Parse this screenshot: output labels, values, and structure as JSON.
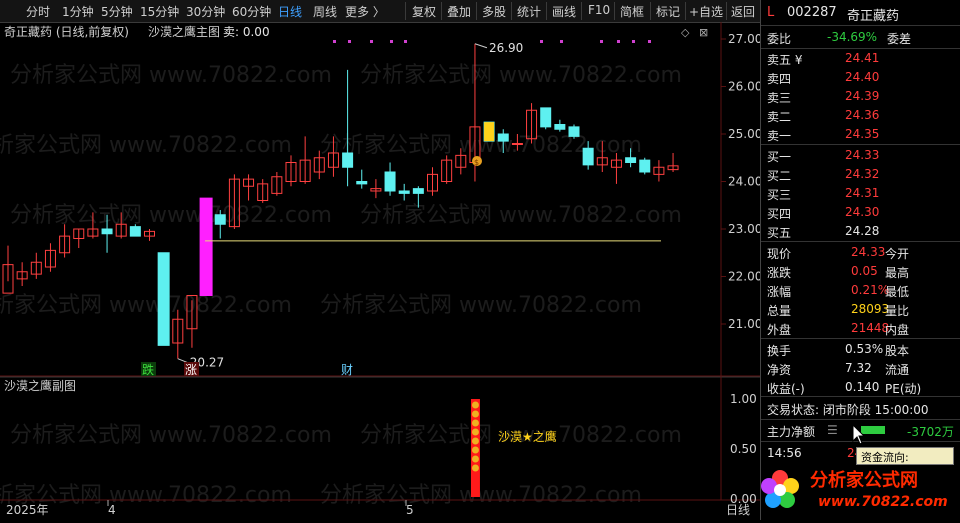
{
  "toolbar": {
    "periods": [
      "分时",
      "1分钟",
      "5分钟",
      "15分钟",
      "30分钟",
      "60分钟",
      "日线",
      "周线",
      "更多 〉"
    ],
    "active_period": "日线",
    "actions": [
      "复权",
      "叠加",
      "多股",
      "统计",
      "画线",
      "F10",
      "简框",
      "标记",
      "+自选",
      "返回"
    ]
  },
  "chart_header": {
    "title": "奇正藏药 (日线,前复权)",
    "indicator": "沙漠之鹰主图",
    "sell_label": "卖: 0.00"
  },
  "price_axis": [
    "27.00",
    "26.00",
    "25.00",
    "24.00",
    "23.00",
    "22.00",
    "21.00"
  ],
  "sub_axis": [
    "1.00",
    "0.50",
    "0.00"
  ],
  "annotations": {
    "high": "26.90",
    "low": "20.27",
    "marker_die": "跌",
    "marker_zhang": "涨",
    "marker_cai": "财",
    "sub_label": "沙漠★之鹰"
  },
  "sub_header": "沙漠之鹰副图",
  "date_axis": [
    "2025年",
    "4",
    "5"
  ],
  "date_corner": "日线",
  "watermark": "分析家公式网 www.70822.com",
  "chart_data": {
    "type": "candlestick",
    "ylim": [
      20.2,
      27.2
    ],
    "candles": [
      {
        "o": 21.65,
        "h": 22.65,
        "l": 21.9,
        "c": 22.25
      },
      {
        "o": 21.95,
        "h": 22.3,
        "l": 21.8,
        "c": 22.1
      },
      {
        "o": 22.05,
        "h": 22.5,
        "l": 21.95,
        "c": 22.3
      },
      {
        "o": 22.2,
        "h": 22.7,
        "l": 22.1,
        "c": 22.55
      },
      {
        "o": 22.5,
        "h": 23.1,
        "l": 22.4,
        "c": 22.85
      },
      {
        "o": 22.8,
        "h": 23.0,
        "l": 22.6,
        "c": 23.0
      },
      {
        "o": 22.85,
        "h": 23.35,
        "l": 22.8,
        "c": 23.0
      },
      {
        "o": 23.0,
        "h": 23.3,
        "l": 22.5,
        "c": 22.9
      },
      {
        "o": 22.85,
        "h": 23.35,
        "l": 22.8,
        "c": 23.1
      },
      {
        "o": 23.05,
        "h": 23.1,
        "l": 22.85,
        "c": 22.85
      },
      {
        "o": 22.85,
        "h": 23.0,
        "l": 22.75,
        "c": 22.95
      },
      {
        "o": 22.5,
        "h": 22.5,
        "l": 20.55,
        "c": 20.55
      },
      {
        "o": 20.6,
        "h": 21.3,
        "l": 20.27,
        "c": 21.1
      },
      {
        "o": 20.9,
        "h": 21.5,
        "l": 20.5,
        "c": 21.6
      },
      {
        "o": 21.6,
        "h": 23.65,
        "l": 21.6,
        "c": 23.65
      },
      {
        "o": 23.3,
        "h": 23.4,
        "l": 22.8,
        "c": 23.1
      },
      {
        "o": 23.05,
        "h": 24.15,
        "l": 23.0,
        "c": 24.05
      },
      {
        "o": 23.9,
        "h": 24.15,
        "l": 23.6,
        "c": 24.05
      },
      {
        "o": 23.6,
        "h": 24.05,
        "l": 23.55,
        "c": 23.95
      },
      {
        "o": 23.75,
        "h": 24.2,
        "l": 23.7,
        "c": 24.1
      },
      {
        "o": 24.0,
        "h": 24.55,
        "l": 23.9,
        "c": 24.4
      },
      {
        "o": 24.0,
        "h": 24.95,
        "l": 23.95,
        "c": 24.45
      },
      {
        "o": 24.2,
        "h": 24.65,
        "l": 24.05,
        "c": 24.5
      },
      {
        "o": 24.3,
        "h": 24.95,
        "l": 24.1,
        "c": 24.6
      },
      {
        "o": 24.6,
        "h": 26.35,
        "l": 23.9,
        "c": 24.3
      },
      {
        "o": 24.0,
        "h": 24.25,
        "l": 23.85,
        "c": 23.95
      },
      {
        "o": 23.8,
        "h": 24.05,
        "l": 23.65,
        "c": 23.85
      },
      {
        "o": 24.2,
        "h": 24.4,
        "l": 23.7,
        "c": 23.8
      },
      {
        "o": 23.8,
        "h": 23.95,
        "l": 23.6,
        "c": 23.75
      },
      {
        "o": 23.85,
        "h": 23.9,
        "l": 23.45,
        "c": 23.75
      },
      {
        "o": 23.8,
        "h": 24.3,
        "l": 23.7,
        "c": 24.15
      },
      {
        "o": 24.0,
        "h": 24.55,
        "l": 23.95,
        "c": 24.45
      },
      {
        "o": 24.3,
        "h": 24.7,
        "l": 24.15,
        "c": 24.55
      },
      {
        "o": 24.4,
        "h": 26.9,
        "l": 24.0,
        "c": 25.15
      },
      {
        "o": 25.25,
        "h": 25.25,
        "l": 24.95,
        "c": 24.85
      },
      {
        "o": 25.0,
        "h": 25.1,
        "l": 24.6,
        "c": 24.85
      },
      {
        "o": 24.8,
        "h": 25.0,
        "l": 24.65,
        "c": 24.8
      },
      {
        "o": 24.9,
        "h": 25.65,
        "l": 24.8,
        "c": 25.5
      },
      {
        "o": 25.55,
        "h": 25.55,
        "l": 25.1,
        "c": 25.15
      },
      {
        "o": 25.2,
        "h": 25.3,
        "l": 25.05,
        "c": 25.1
      },
      {
        "o": 25.15,
        "h": 25.2,
        "l": 24.9,
        "c": 24.95
      },
      {
        "o": 24.7,
        "h": 24.85,
        "l": 24.25,
        "c": 24.35
      },
      {
        "o": 24.35,
        "h": 24.85,
        "l": 24.2,
        "c": 24.5
      },
      {
        "o": 24.3,
        "h": 24.6,
        "l": 23.95,
        "c": 24.45
      },
      {
        "o": 24.5,
        "h": 24.7,
        "l": 24.3,
        "c": 24.4
      },
      {
        "o": 24.45,
        "h": 24.5,
        "l": 24.15,
        "c": 24.2
      },
      {
        "o": 24.15,
        "h": 24.45,
        "l": 24.0,
        "c": 24.3
      },
      {
        "o": 24.25,
        "h": 24.6,
        "l": 24.2,
        "c": 24.33
      }
    ],
    "support_line": 22.75,
    "sub_signal_value": 1.0
  },
  "right_panel": {
    "header_prefix": "L",
    "code": "002287",
    "name": "奇正藏药",
    "weibi_label": "委比",
    "weibi_value": "-34.69%",
    "weicha_label": "委差",
    "sells": [
      {
        "label": "卖五 ¥",
        "price": "24.41"
      },
      {
        "label": "卖四",
        "price": "24.40"
      },
      {
        "label": "卖三",
        "price": "24.39"
      },
      {
        "label": "卖二",
        "price": "24.36"
      },
      {
        "label": "卖一",
        "price": "24.35"
      }
    ],
    "buys": [
      {
        "label": "买一",
        "price": "24.33"
      },
      {
        "label": "买二",
        "price": "24.32"
      },
      {
        "label": "买三",
        "price": "24.31"
      },
      {
        "label": "买四",
        "price": "24.30"
      },
      {
        "label": "买五",
        "price": "24.28"
      }
    ],
    "quote": [
      {
        "l": "现价",
        "v": "24.33",
        "r": "今开"
      },
      {
        "l": "涨跌",
        "v": "0.05",
        "r": "最高"
      },
      {
        "l": "涨幅",
        "v": "0.21%",
        "r": "最低"
      },
      {
        "l": "总量",
        "v": "28093",
        "r": "量比"
      },
      {
        "l": "外盘",
        "v": "21448",
        "r": "内盘"
      }
    ],
    "stats": [
      {
        "l": "换手",
        "v": "0.53%",
        "r": "股本"
      },
      {
        "l": "净资",
        "v": "7.32",
        "r": "流通"
      },
      {
        "l": "收益(-)",
        "v": "0.140",
        "r": "PE(动)"
      }
    ],
    "trade_status": "交易状态: 闭市阶段 15:00:00",
    "main_flow_label": "主力净额",
    "main_flow_value": "-3702万",
    "time": "14:56",
    "time_value": "24",
    "tooltip": "资金流向:"
  },
  "logo": {
    "main": "分析家公式网",
    "sub": "www.70822.com"
  }
}
